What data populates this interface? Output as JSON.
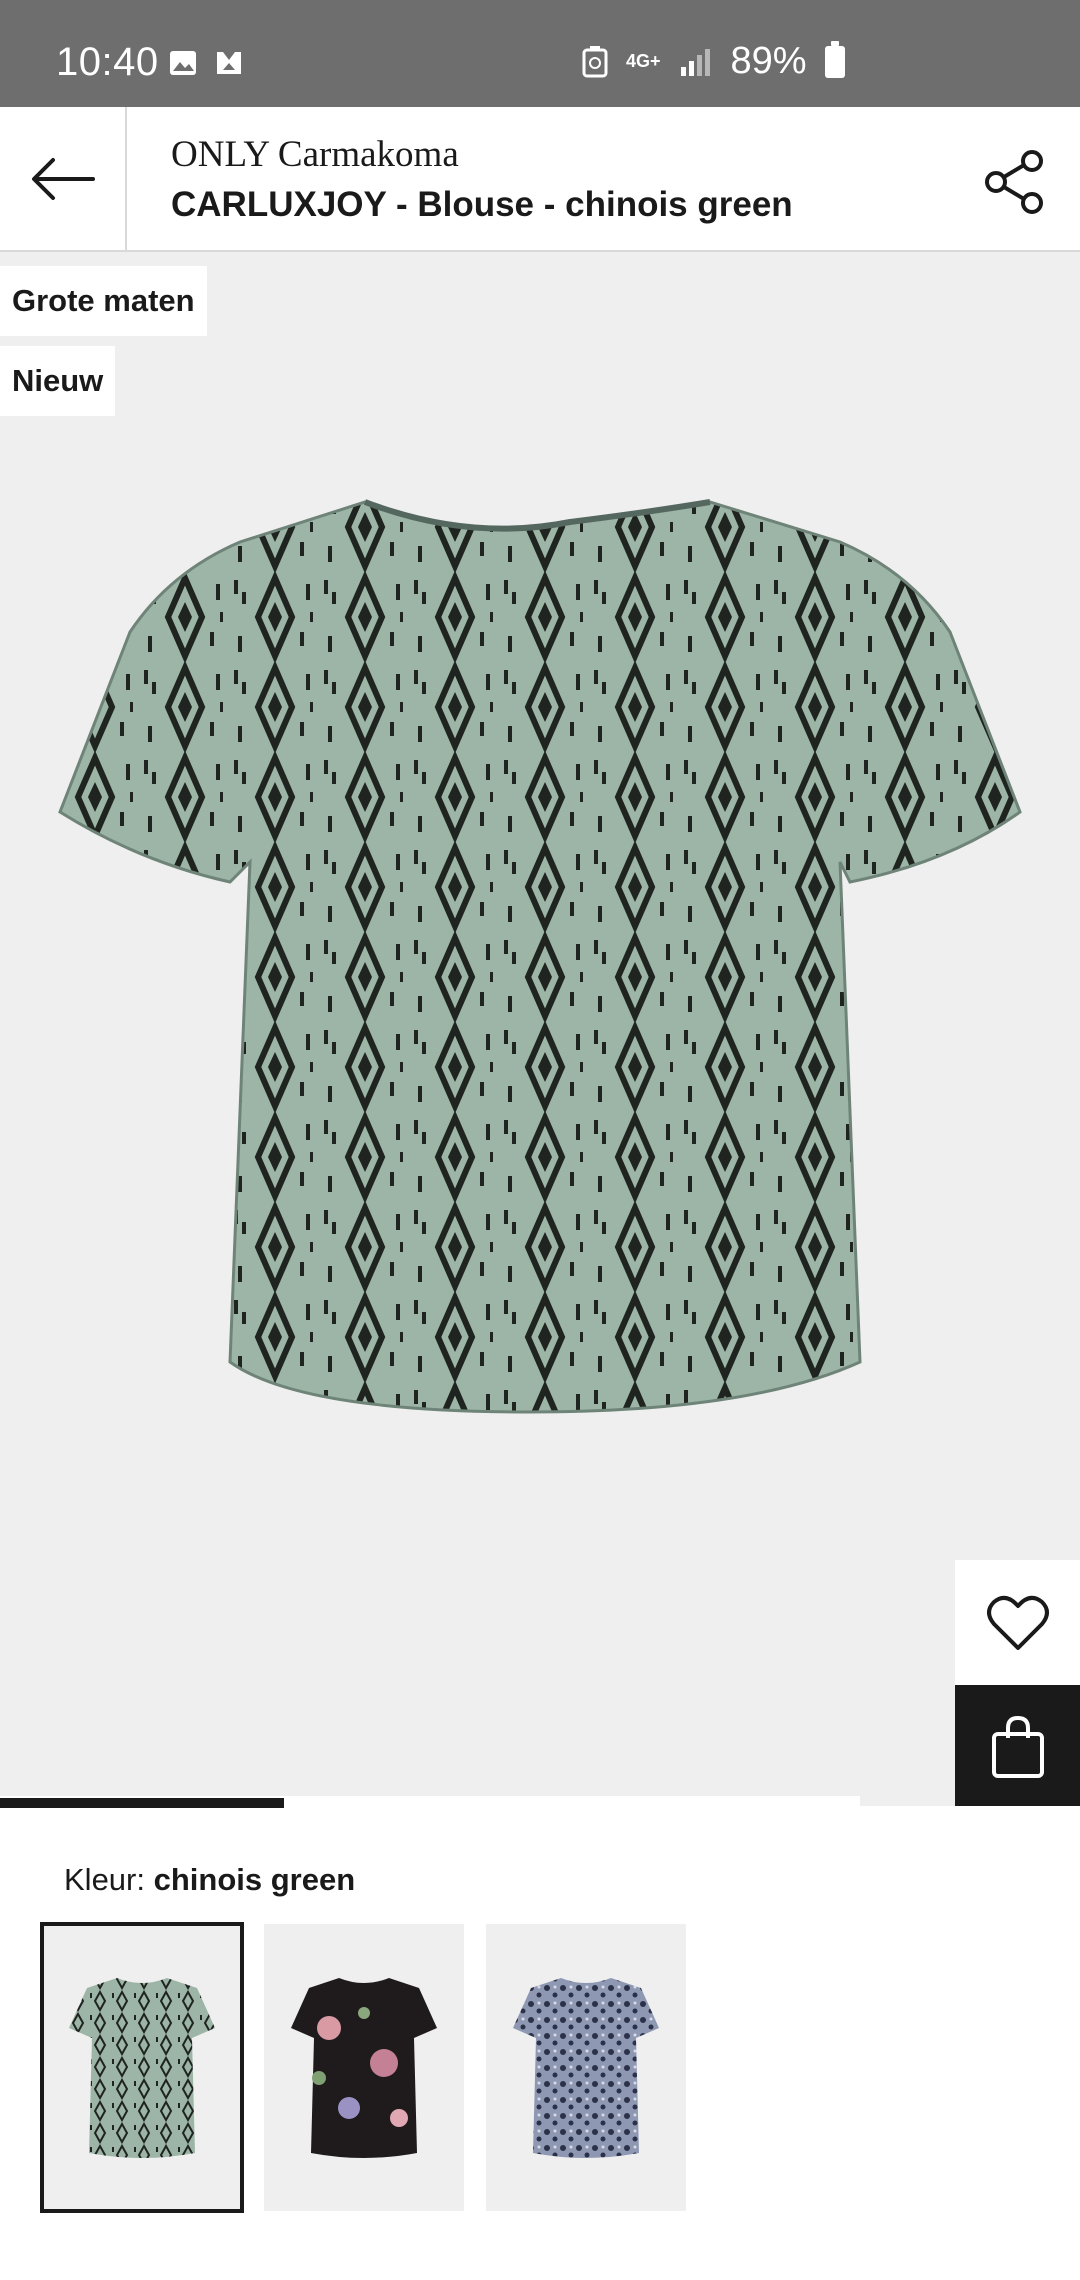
{
  "status_bar": {
    "time": "10:40",
    "network": "4G+",
    "battery": "89%"
  },
  "header": {
    "brand": "ONLY Carmakoma",
    "product_title": "CARLUXJOY - Blouse - chinois green"
  },
  "badges": [
    "Grote maten",
    "Nieuw"
  ],
  "color": {
    "label": "Kleur:",
    "value": "chinois green",
    "swatches": [
      {
        "name": "chinois green",
        "color": "#9cb5a6",
        "selected": true
      },
      {
        "name": "black floral",
        "color": "#1f1b1c",
        "selected": false
      },
      {
        "name": "blue print",
        "color": "#8e98b3",
        "selected": false
      }
    ]
  },
  "gallery": {
    "progress_fraction": 0.33
  },
  "colors": {
    "status_bar_bg": "#6e6e6e",
    "image_bg": "#efefef",
    "accent_dark": "#1a1a1a",
    "shirt_green": "#9cb5a6"
  }
}
